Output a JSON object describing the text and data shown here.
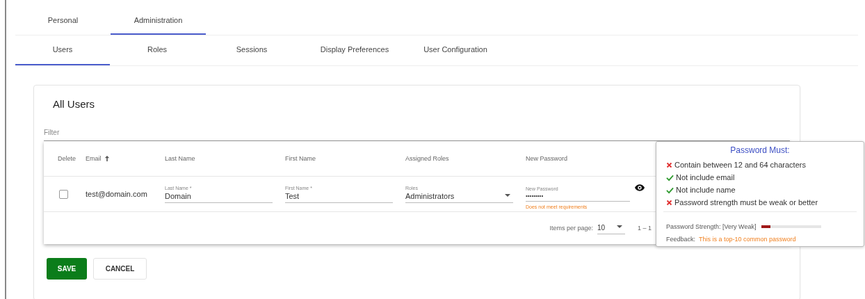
{
  "tabs": [
    {
      "label": "Personal",
      "selected": false
    },
    {
      "label": "Administration",
      "selected": true
    }
  ],
  "subtabs": [
    {
      "label": "Users",
      "selected": true
    },
    {
      "label": "Roles",
      "selected": false
    },
    {
      "label": "Sessions",
      "selected": false
    },
    {
      "label": "Display Preferences",
      "selected": false
    },
    {
      "label": "User Configuration",
      "selected": false
    }
  ],
  "card": {
    "title": "All Users",
    "filter": {
      "placeholder": "Filter"
    }
  },
  "table": {
    "columns": [
      "Delete",
      "Email",
      "Last Name",
      "First Name",
      "Assigned Roles",
      "New Password"
    ],
    "rows": [
      {
        "checked": false,
        "email": "test@domain.com",
        "last_name": {
          "label": "Last Name *",
          "value": "Domain"
        },
        "first_name": {
          "label": "First Name *",
          "value": "Test"
        },
        "roles": {
          "label": "Roles",
          "value": "Administrators"
        },
        "password": {
          "label": "New Password",
          "value": "•••••••••",
          "error": "Does not meet requirements"
        }
      }
    ]
  },
  "paginator": {
    "label": "Items per page:",
    "value": "10",
    "range": "1 – 1"
  },
  "buttons": [
    "SAVE",
    "CANCEL"
  ],
  "popup": {
    "title": "Password Must:",
    "rules": [
      {
        "text": "Contain between 12 and 64 characters",
        "met": false
      },
      {
        "text": "Not include email",
        "met": true
      },
      {
        "text": "Not include name",
        "met": true
      },
      {
        "text": "Password strength must be weak or better",
        "met": false
      }
    ],
    "strength_label": "Password Strength: [Very Weak]",
    "level": 0.15,
    "feedback_label": "Feedback:",
    "feedback": "This is a top-10 common password"
  }
}
